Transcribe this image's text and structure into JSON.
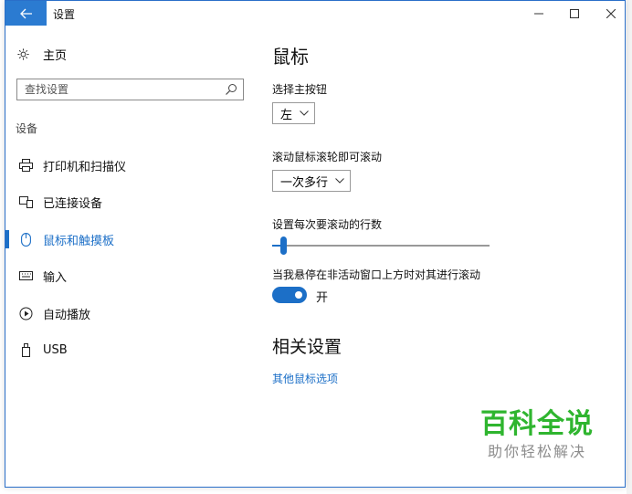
{
  "window": {
    "title": "设置"
  },
  "sidebar": {
    "home_label": "主页",
    "search_placeholder": "查找设置",
    "section_title": "设备",
    "items": [
      {
        "label": "打印机和扫描仪",
        "icon": "printer-icon"
      },
      {
        "label": "已连接设备",
        "icon": "devices-icon"
      },
      {
        "label": "鼠标和触摸板",
        "icon": "mouse-icon",
        "active": true
      },
      {
        "label": "输入",
        "icon": "keyboard-icon"
      },
      {
        "label": "自动播放",
        "icon": "autoplay-icon"
      },
      {
        "label": "USB",
        "icon": "usb-icon"
      }
    ]
  },
  "main": {
    "title": "鼠标",
    "primary_button": {
      "label": "选择主按钮",
      "value": "左"
    },
    "scroll_mode": {
      "label": "滚动鼠标滚轮即可滚动",
      "value": "一次多行"
    },
    "lines_to_scroll": {
      "label": "设置每次要滚动的行数",
      "slider_fraction": 0.05
    },
    "inactive_scroll": {
      "label": "当我悬停在非活动窗口上方时对其进行滚动",
      "state": "开"
    },
    "related_title": "相关设置",
    "related_link": "其他鼠标选项"
  },
  "watermark": {
    "title": "百科全说",
    "subtitle": "助你轻松解决"
  },
  "colors": {
    "accent": "#1c6fc7",
    "watermark_green": "#2fb52f"
  }
}
